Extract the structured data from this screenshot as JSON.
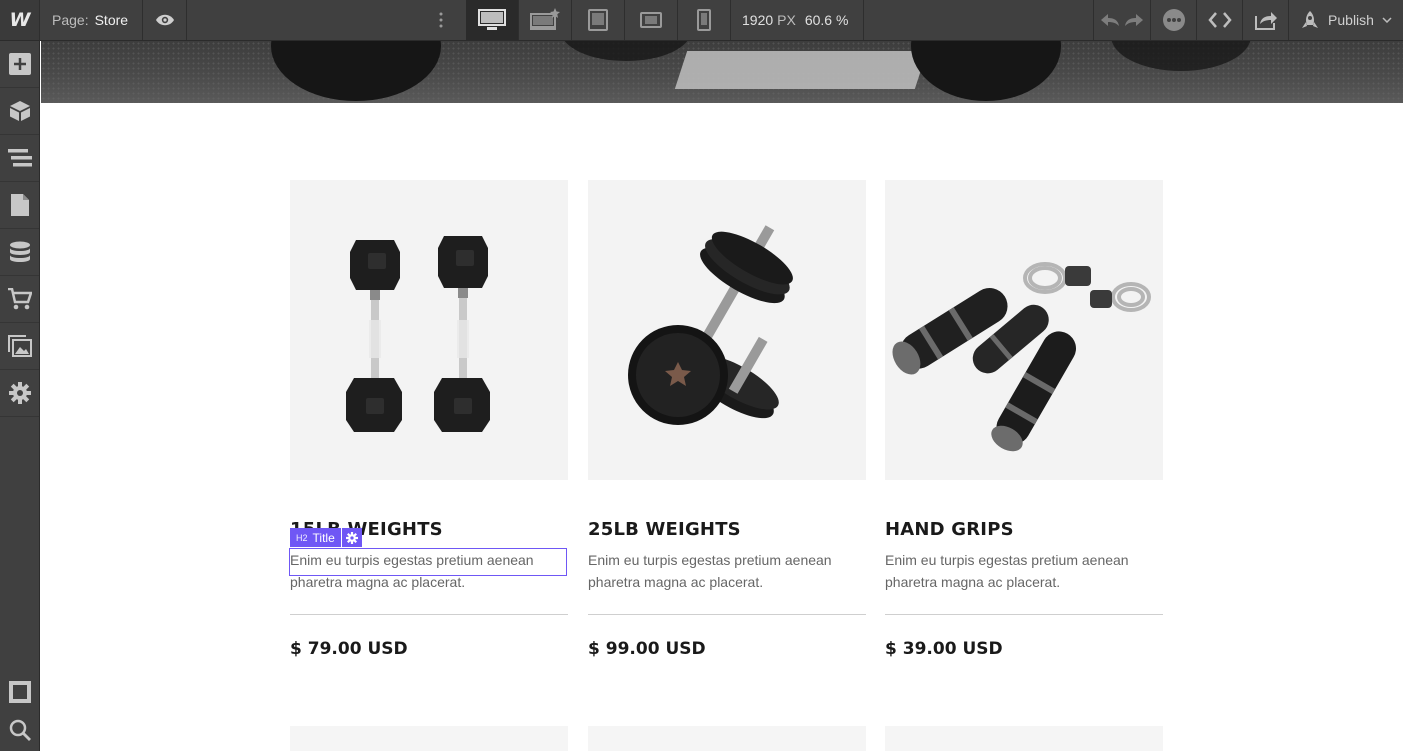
{
  "topbar": {
    "logo": "W",
    "page_label": "Page:",
    "page_name": "Store",
    "width_value": "1920",
    "width_unit": "PX",
    "zoom": "60.6 %",
    "publish_label": "Publish",
    "devices": [
      "desktop-icon",
      "large-desktop-icon",
      "tablet-icon",
      "mobile-landscape-icon",
      "mobile-portrait-icon"
    ],
    "active_device": "desktop-icon"
  },
  "leftbar": {
    "items": [
      "add-icon",
      "components-icon",
      "navigator-icon",
      "pages-icon",
      "cms-icon",
      "ecommerce-icon",
      "assets-icon",
      "settings-icon"
    ],
    "bottom": [
      "preview-frame-icon",
      "search-icon"
    ]
  },
  "selection": {
    "tag": "H2",
    "label": "Title",
    "accent": "#6f57f5"
  },
  "products": [
    {
      "title": "15LB WEIGHTS",
      "desc": "Enim eu turpis egestas pretium aenean pharetra magna ac placerat.",
      "price": "$ 79.00 USD"
    },
    {
      "title": "25LB WEIGHTS",
      "desc": "Enim eu turpis egestas pretium aenean pharetra magna ac placerat.",
      "price": "$ 99.00 USD"
    },
    {
      "title": "HAND GRIPS",
      "desc": "Enim eu turpis egestas pretium aenean pharetra magna ac placerat.",
      "price": "$ 39.00 USD"
    }
  ]
}
